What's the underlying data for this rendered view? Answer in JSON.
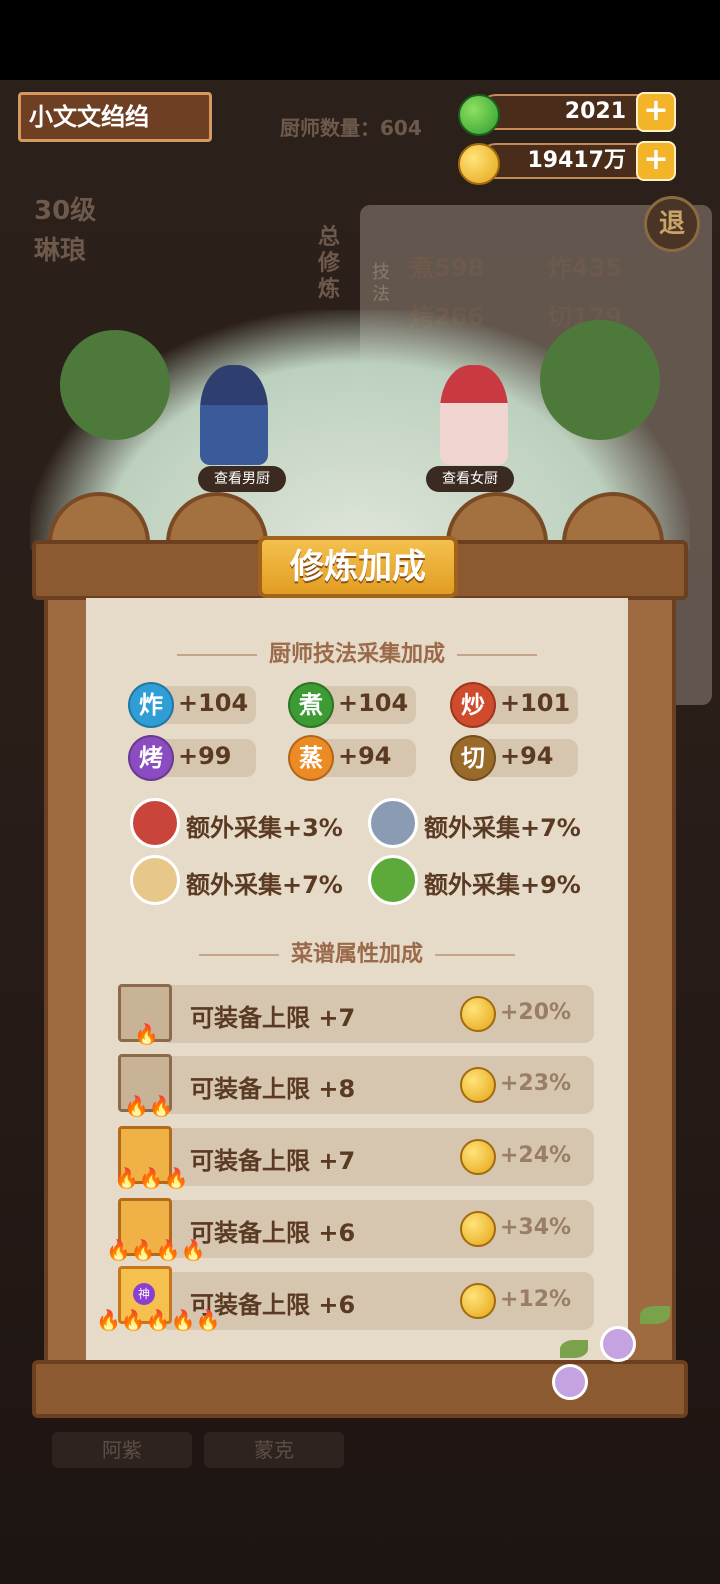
{
  "header": {
    "player_name": "小文文绉绉",
    "chef_count_label": "厨师数量：604",
    "jade_value": "2021",
    "coin_value": "19417万",
    "plus": "+"
  },
  "background": {
    "level": "30级",
    "chef_name": "琳琅",
    "side_label": "总修炼",
    "exit": "退",
    "skills_tag": "技法",
    "bg_values": [
      "煮598",
      "炸435",
      "烤266",
      "切179"
    ],
    "bottom_names": [
      "阿紫",
      "蒙克"
    ]
  },
  "scene": {
    "view_male": "查看男厨",
    "view_female": "查看女厨"
  },
  "panel": {
    "title": "修炼加成",
    "section1": "厨师技法采集加成",
    "skills": [
      {
        "glyph": "炸",
        "value": "+104",
        "color": "#2f9ed6"
      },
      {
        "glyph": "煮",
        "value": "+104",
        "color": "#3d9b34"
      },
      {
        "glyph": "炒",
        "value": "+101",
        "color": "#d04a2c"
      },
      {
        "glyph": "烤",
        "value": "+99",
        "color": "#8a4cc0"
      },
      {
        "glyph": "蒸",
        "value": "+94",
        "color": "#ec8a24"
      },
      {
        "glyph": "切",
        "value": "+94",
        "color": "#9a6a2a"
      }
    ],
    "extras": [
      {
        "icon": "meat-icon",
        "text": "额外采集+3%",
        "color": "#c9453b"
      },
      {
        "icon": "fish-icon",
        "text": "额外采集+7%",
        "color": "#8b9bb3"
      },
      {
        "icon": "flour-icon",
        "text": "额外采集+7%",
        "color": "#e8c88a"
      },
      {
        "icon": "vegetable-icon",
        "text": "额外采集+9%",
        "color": "#5daa3a"
      }
    ],
    "section2": "菜谱属性加成",
    "recipes": [
      {
        "label": "可装备上限 +7",
        "bonus": "+20%",
        "flames": "🔥"
      },
      {
        "label": "可装备上限 +8",
        "bonus": "+23%",
        "flames": "🔥🔥"
      },
      {
        "label": "可装备上限 +7",
        "bonus": "+24%",
        "flames": "🔥🔥🔥"
      },
      {
        "label": "可装备上限 +6",
        "bonus": "+34%",
        "flames": "🔥🔥🔥🔥"
      },
      {
        "label": "可装备上限 +6",
        "bonus": "+12%",
        "flames": "🔥🔥🔥🔥🔥"
      }
    ],
    "shen_badge": "神"
  }
}
